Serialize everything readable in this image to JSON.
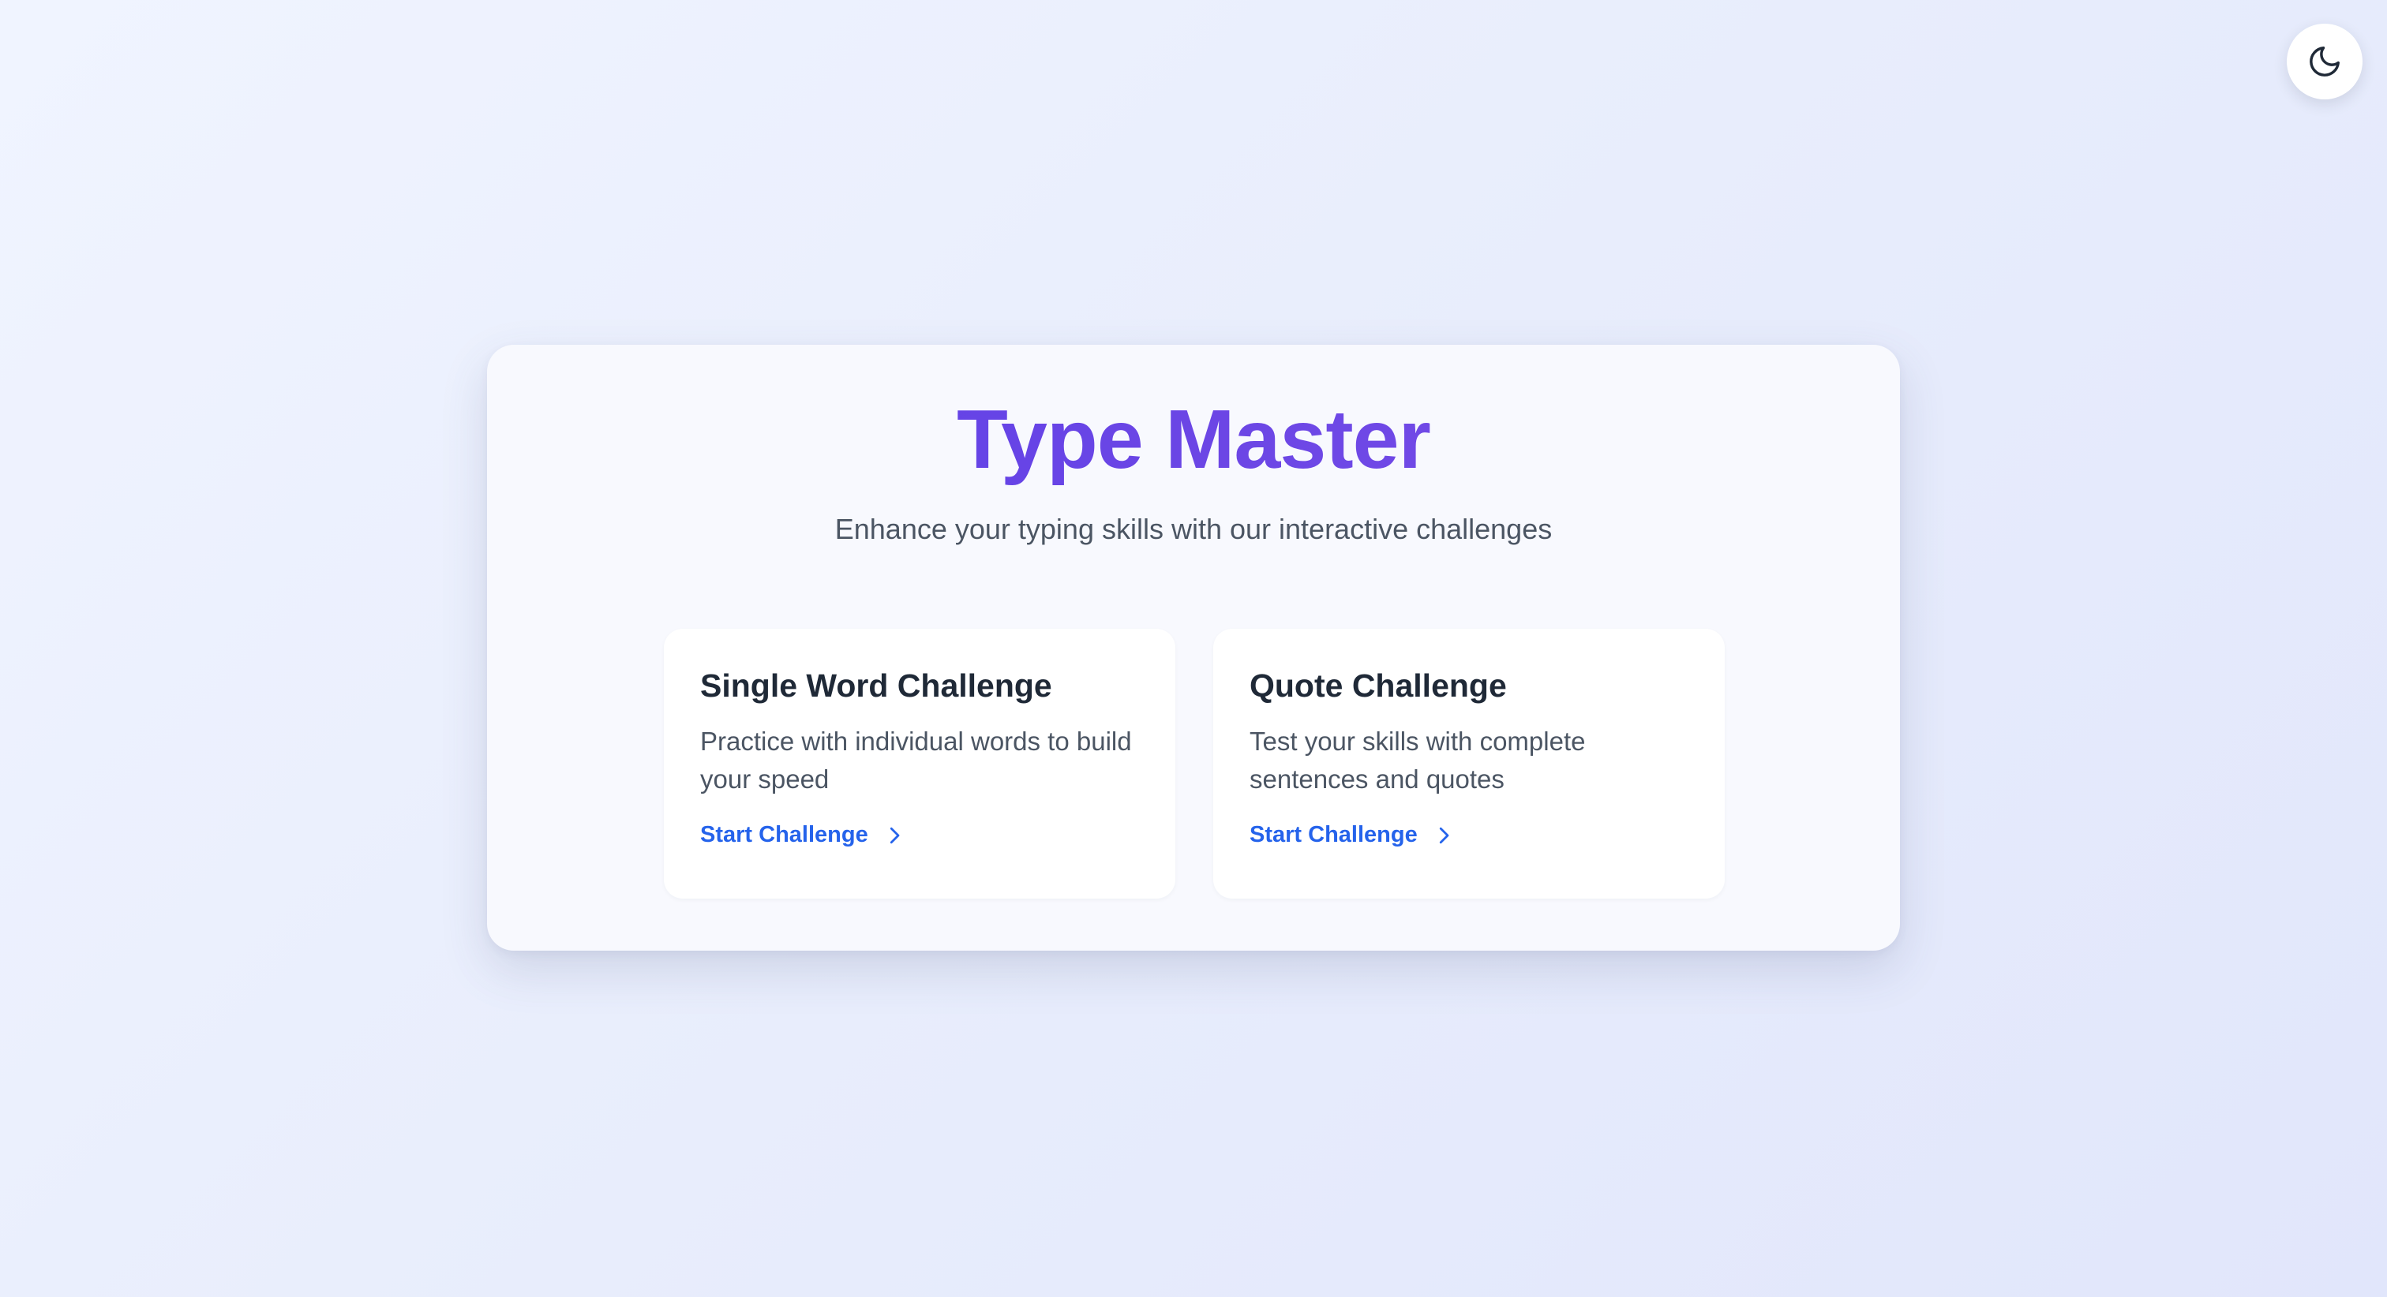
{
  "theme_toggle": {
    "icon": "moon-icon"
  },
  "hero": {
    "title": "Type Master",
    "subtitle": "Enhance your typing skills with our interactive challenges"
  },
  "challenges": [
    {
      "title": "Single Word Challenge",
      "description": "Practice with individual words to build your speed",
      "action_label": "Start Challenge",
      "action_icon": "chevron-right-icon"
    },
    {
      "title": "Quote Challenge",
      "description": "Test your skills with complete sentences and quotes",
      "action_label": "Start Challenge",
      "action_icon": "chevron-right-icon"
    }
  ],
  "colors": {
    "title_gradient_start": "#5a3ee8",
    "title_gradient_end": "#7a4fe8",
    "link": "#2563eb",
    "heading": "#1f2937",
    "body_text": "#4b5563"
  }
}
